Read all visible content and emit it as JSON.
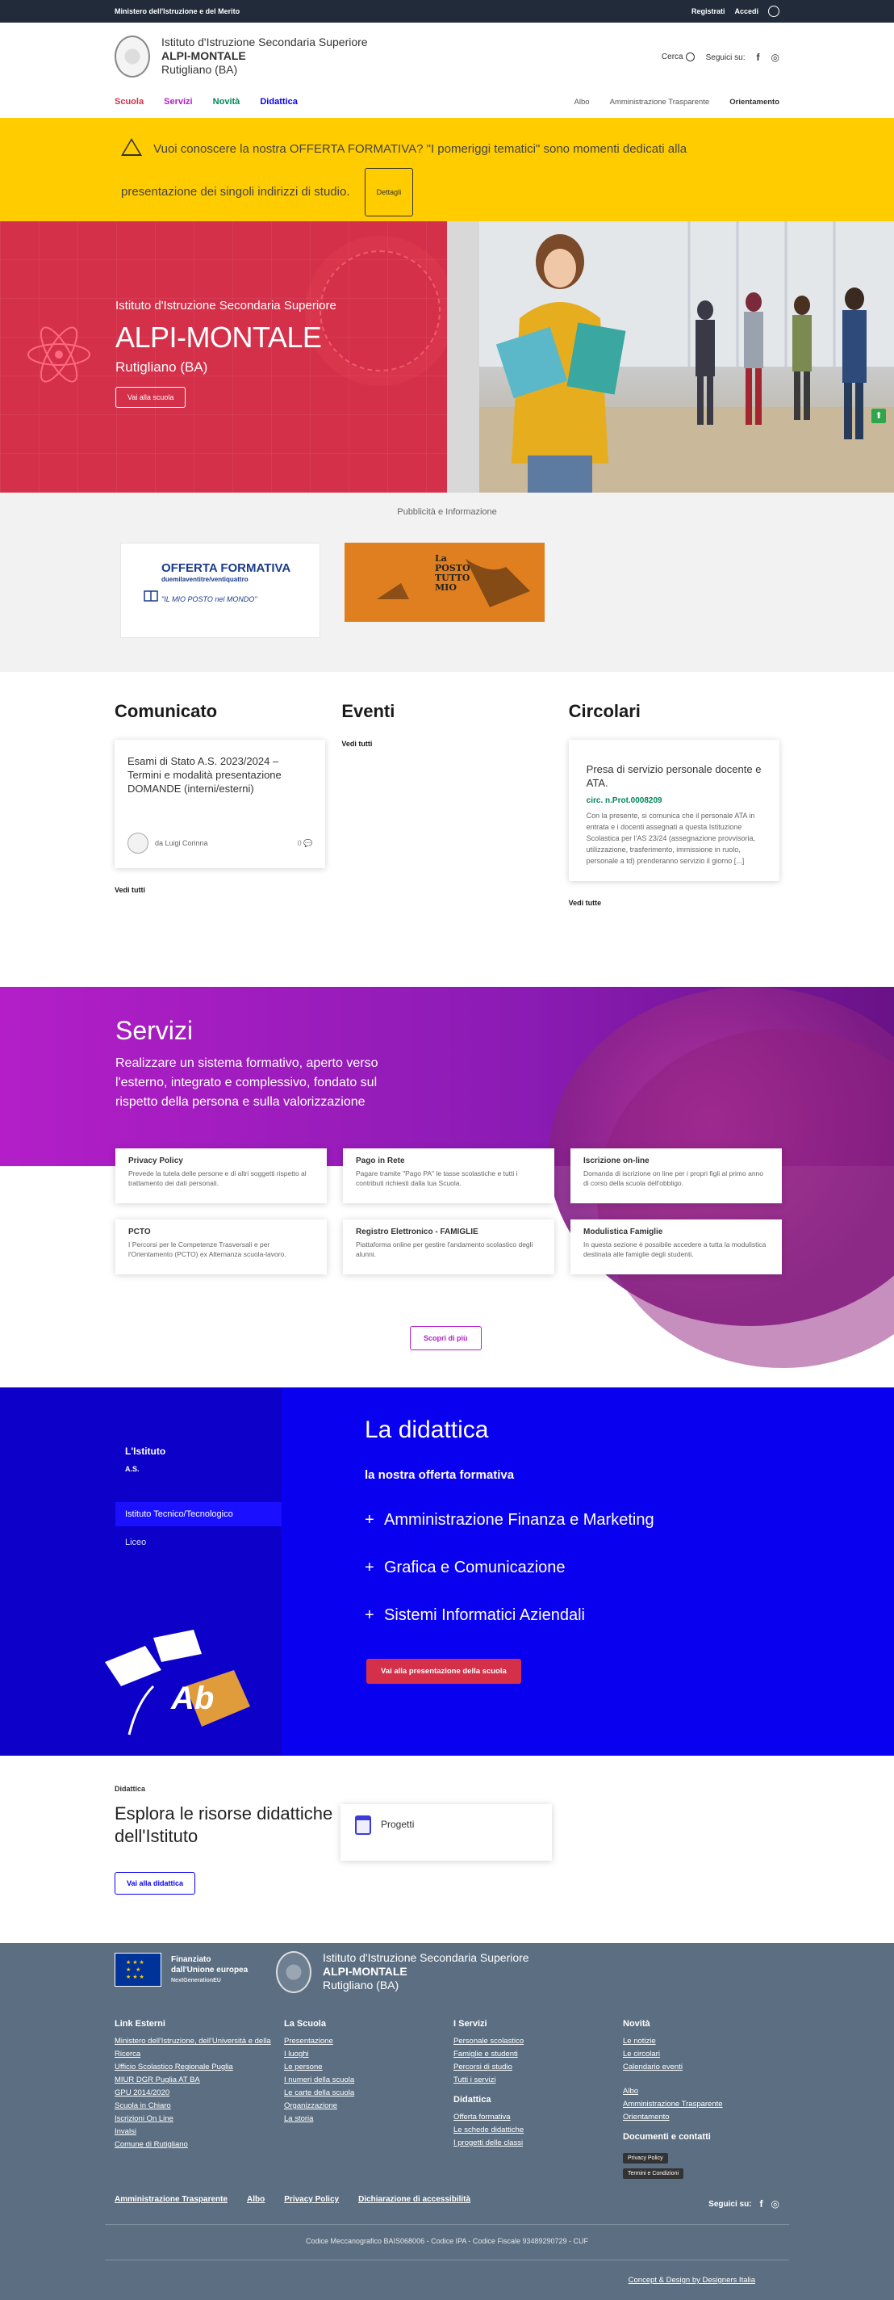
{
  "topbar": {
    "ministry": "Ministero dell'Istruzione e del Merito",
    "register": "Registrati",
    "login": "Accedi"
  },
  "header": {
    "school_type": "Istituto d'Istruzione Secondaria Superiore",
    "school_name": "ALPI-MONTALE",
    "school_place": "Rutigliano (BA)",
    "search": "Cerca",
    "follow": "Seguici su:",
    "nav_main": [
      "Scuola",
      "Servizi",
      "Novità",
      "Didattica"
    ],
    "nav_colors": [
      "#d43049",
      "#b31ec8",
      "#008758",
      "#0a00f0"
    ],
    "nav_secondary": [
      "Albo",
      "Amministrazione Trasparente",
      "Orientamento"
    ]
  },
  "alert": {
    "text_line1": "Vuoi conoscere la nostra OFFERTA FORMATIVA? \"I pomeriggi tematici\" sono momenti dedicati alla",
    "text_line2": "presentazione dei singoli indirizzi di studio.",
    "button": "Dettagli"
  },
  "hero": {
    "subtitle": "Istituto d'Istruzione Secondaria Superiore",
    "title": "ALPI-MONTALE",
    "place": "Rutigliano (BA)",
    "button": "Vai alla scuola"
  },
  "ads": {
    "title": "Pubblicità e Informazione",
    "ad1_title": "OFFERTA FORMATIVA",
    "ad1_sub": "duemilaventitre/ventiquattro",
    "ad1_line": "\"IL MIO POSTO nel MONDO\"",
    "ad2_text": "La POSTO TUTTO MIO"
  },
  "news": {
    "comunicato": {
      "heading": "Comunicato",
      "card_title": "Esami di Stato A.S. 2023/2024 – Termini e modalità presentazione DOMANDE (interni/esterni)",
      "author_prefix": "da",
      "author": "Luigi Corinna",
      "comments": "0",
      "more": "Vedi tutti"
    },
    "eventi": {
      "heading": "Eventi",
      "more": "Vedi tutti"
    },
    "circolari": {
      "heading": "Circolari",
      "card_title": "Presa di servizio personale docente e ATA.",
      "ref": "circ. n.Prot.0008209",
      "text": "Con la presente, si comunica che il personale ATA in entrata e i docenti assegnati a questa Istituzione Scolastica per l'AS 23/24 (assegnazione provvisoria, utilizzazione, trasferimento, immissione in ruolo, personale a td) prenderanno servizio il giorno [...]",
      "more": "Vedi tutte"
    }
  },
  "services": {
    "title": "Servizi",
    "description": "Realizzare un sistema formativo, aperto verso l'esterno, integrato e complessivo, fondato sul rispetto della persona e sulla valorizzazione",
    "cards": [
      {
        "title": "Privacy Policy",
        "desc": "Prevede la tutela delle persone e di altri soggetti rispetto al trattamento dei dati personali."
      },
      {
        "title": "Pago in Rete",
        "desc": "Pagare tramite \"Pago PA\" le tasse scolastiche e tutti i contributi richiesti dalla tua Scuola."
      },
      {
        "title": "Iscrizione on-line",
        "desc": "Domanda di iscrizione on line per i propri figli al primo anno di corso della scuola dell'obbligo."
      },
      {
        "title": "PCTO",
        "desc": "I Percorsi per le Competenze Trasversali e per l'Orientamento (PCTO) ex Alternanza scuola-lavoro."
      },
      {
        "title": "Registro Elettronico - FAMIGLIE",
        "desc": "Piattaforma online per gestire l'andamento scolastico degli alunni."
      },
      {
        "title": "Modulistica Famiglie",
        "desc": "In questa sezione è possibile accedere a tutta la modulistica destinata alle famiglie degli studenti."
      }
    ],
    "button": "Scopri di più"
  },
  "didattica": {
    "side_title": "L'Istituto",
    "side_year": "A.S.",
    "side_active": "Istituto Tecnico/Tecnologico",
    "side_other": "Liceo",
    "title": "La didattica",
    "subtitle": "la nostra offerta formativa",
    "items": [
      "Amministrazione Finanza e Marketing",
      "Grafica e Comunicazione",
      "Sistemi Informatici Aziendali"
    ],
    "button": "Vai alla presentazione della scuola",
    "illus_text": "Ab"
  },
  "resources": {
    "kicker": "Didattica",
    "title": "Esplora le risorse didattiche dell'Istituto",
    "card": "Progetti",
    "button": "Vai alla didattica"
  },
  "footer": {
    "eu_line1": "Finanziato",
    "eu_line2": "dall'Unione europea",
    "eu_line3": "NextGenerationEU",
    "columns": [
      {
        "title": "Link Esterni",
        "links": [
          "Ministero dell'Istruzione, dell'Università e della Ricerca",
          "Ufficio Scolastico Regionale Puglia",
          "MIUR DGR Puglia AT BA",
          "GPU 2014/2020",
          "Scuola in Chiaro",
          "Iscrizioni On Line",
          "Invalsi",
          "Comune di Rutigliano"
        ]
      },
      {
        "title": "La Scuola",
        "links": [
          "Presentazione",
          "I luoghi",
          "Le persone",
          "I numeri della scuola",
          "Le carte della scuola",
          "Organizzazione",
          "La storia"
        ]
      },
      {
        "title": "I Servizi",
        "links": [
          "Personale scolastico",
          "Famiglie e studenti",
          "Percorsi di studio",
          "Tutti i servizi"
        ],
        "title2": "Didattica",
        "links2": [
          "Offerta formativa",
          "Le schede didattiche",
          "I progetti delle classi"
        ]
      },
      {
        "title": "Novità",
        "links": [
          "Le notizie",
          "Le circolari",
          "Calendario eventi"
        ],
        "links2": [
          "Albo",
          "Amministrazione Trasparente",
          "Orientamento"
        ],
        "title2": "Documenti e contatti",
        "badges": [
          "Privacy Policy",
          "Termini e Condizioni"
        ]
      }
    ],
    "legal": [
      "Amministrazione Trasparente",
      "Albo",
      "Privacy Policy",
      "Dichiarazione di accessibilità"
    ],
    "follow": "Seguici su:",
    "codes": "Codice Meccanografico BAIS068006 - Codice IPA - Codice Fiscale 93489290729 - CUF",
    "credit": "Concept & Design by Designers Italia"
  }
}
